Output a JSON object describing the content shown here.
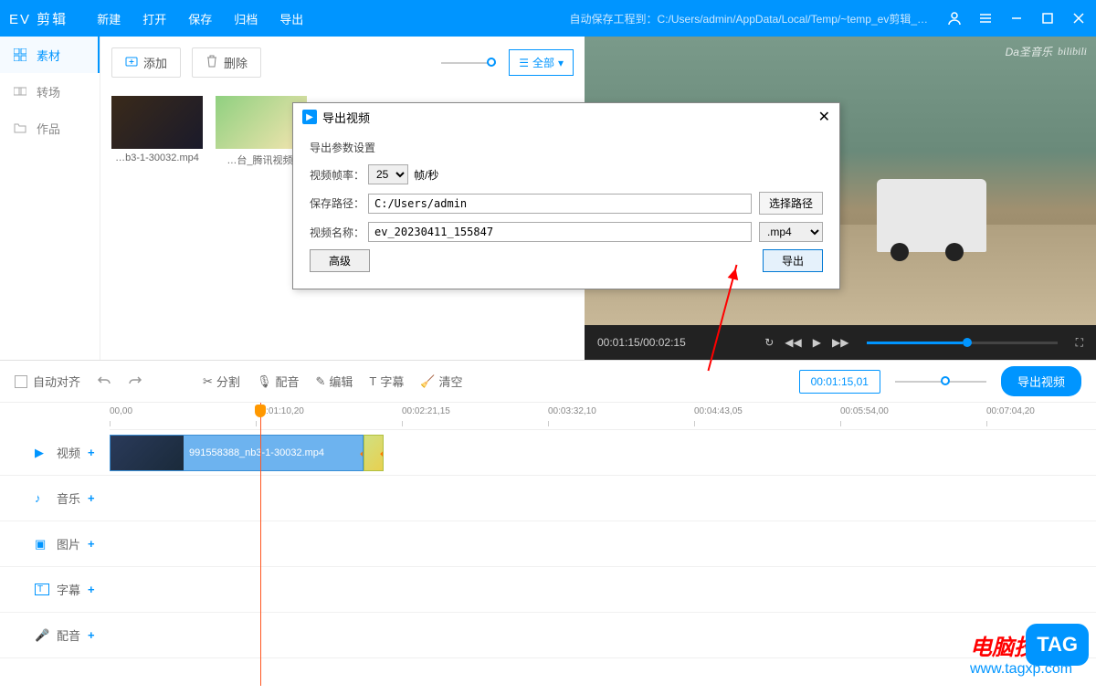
{
  "titlebar": {
    "logo": "EV 剪辑",
    "menu": [
      "新建",
      "打开",
      "保存",
      "归档",
      "导出"
    ],
    "autosave": "自动保存工程到：C:/Users/admin/AppData/Local/Temp/~temp_ev剪辑_…"
  },
  "sidebar": {
    "items": [
      {
        "label": "素材",
        "icon": "grid"
      },
      {
        "label": "转场",
        "icon": "transition"
      },
      {
        "label": "作品",
        "icon": "folder"
      }
    ]
  },
  "media_toolbar": {
    "add": "添加",
    "delete": "删除",
    "filter": "全部"
  },
  "media_items": [
    {
      "name": "…b3-1-30032.mp4"
    },
    {
      "name": "…台_腾讯视频."
    }
  ],
  "preview": {
    "watermark_left": "Da圣音乐",
    "watermark_right": "bilibili",
    "time_current": "00:01:15",
    "time_total": "00:02:15"
  },
  "tl_toolbar": {
    "auto_align": "自动对齐",
    "tools": [
      "分割",
      "配音",
      "编辑",
      "字幕",
      "清空"
    ],
    "timecode": "00:01:15,01",
    "export": "导出视频"
  },
  "ruler_ticks": [
    {
      "label": "00,00",
      "pos": 0
    },
    {
      "label": "00:01:10,20",
      "pos": 160
    },
    {
      "label": "00:02:21,15",
      "pos": 320
    },
    {
      "label": "00:03:32,10",
      "pos": 480
    },
    {
      "label": "00:04:43,05",
      "pos": 640
    },
    {
      "label": "00:05:54,00",
      "pos": 800
    },
    {
      "label": "00:07:04,20",
      "pos": 960
    }
  ],
  "tracks": [
    {
      "label": "视频",
      "icon": "▶"
    },
    {
      "label": "音乐",
      "icon": "♪"
    },
    {
      "label": "图片",
      "icon": "▣"
    },
    {
      "label": "字幕",
      "icon": "T"
    },
    {
      "label": "配音",
      "icon": "🎤"
    }
  ],
  "clip": {
    "name": "991558388_nb3-1-30032.mp4"
  },
  "dialog": {
    "title": "导出视频",
    "section": "导出参数设置",
    "fps_label": "视频帧率：",
    "fps_value": "25",
    "fps_unit": "帧/秒",
    "path_label": "保存路径：",
    "path_value": "C:/Users/admin",
    "browse": "选择路径",
    "name_label": "视频名称：",
    "name_value": "ev_20230411_155847",
    "ext": ".mp4",
    "advanced": "高级",
    "export": "导出"
  },
  "watermark": {
    "cn": "电脑技术网",
    "en": "www.tagxp.com",
    "tag": "TAG"
  }
}
